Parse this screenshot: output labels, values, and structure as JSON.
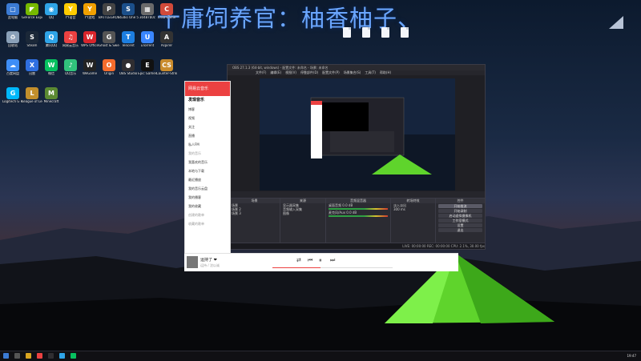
{
  "overlay_title": "十庸饲养官：柚香柚子、",
  "desktop_icons": [
    {
      "label": "此电脑",
      "color": "#3b7bd4",
      "glyph": "▢"
    },
    {
      "label": "GeForce Experience",
      "color": "#76b900",
      "glyph": "◤"
    },
    {
      "label": "QQ",
      "color": "#2fa4e7",
      "glyph": "◉"
    },
    {
      "label": "YY语音",
      "color": "#ffcc00",
      "glyph": "Y"
    },
    {
      "label": "YY游戏",
      "color": "#f0a000",
      "glyph": "Y"
    },
    {
      "label": "BATTLEGROUNDS",
      "color": "#444",
      "glyph": "P"
    },
    {
      "label": "Studio One 5",
      "color": "#1b4f8a",
      "glyph": "S"
    },
    {
      "label": "30487b0c",
      "color": "#6a6a6a",
      "glyph": "▦"
    },
    {
      "label": "Crab Game",
      "color": "#d04a3a",
      "glyph": "C"
    },
    {
      "label": "回收站",
      "color": "#8aa0b8",
      "glyph": "♻"
    },
    {
      "label": "Steam",
      "color": "#1b2838",
      "glyph": "S"
    },
    {
      "label": "腾讯QQ",
      "color": "#2fa4e7",
      "glyph": "Q"
    },
    {
      "label": "网易云音乐",
      "color": "#ec4141",
      "glyph": "♫"
    },
    {
      "label": "WPS Office",
      "color": "#d9262c",
      "glyph": "W"
    },
    {
      "label": "Ghost & Sweeper",
      "color": "#555",
      "glyph": "G"
    },
    {
      "label": "Tencent",
      "color": "#1d7ee0",
      "glyph": "T"
    },
    {
      "label": "uTorrent",
      "color": "#3a86ff",
      "glyph": "U"
    },
    {
      "label": "Aspirer",
      "color": "#333",
      "glyph": "A"
    },
    {
      "label": "百度网盘",
      "color": "#3e8ef7",
      "glyph": "☁"
    },
    {
      "label": "迅雷",
      "color": "#2f6fe0",
      "glyph": "X"
    },
    {
      "label": "微信",
      "color": "#07c160",
      "glyph": "W"
    },
    {
      "label": "QQ音乐",
      "color": "#31c27c",
      "glyph": "♪"
    },
    {
      "label": "WeGame",
      "color": "#222",
      "glyph": "W"
    },
    {
      "label": "Origin",
      "color": "#f56c2d",
      "glyph": "O"
    },
    {
      "label": "OBS Studio",
      "color": "#302e31",
      "glyph": "●"
    },
    {
      "label": "Epic Games",
      "color": "#111",
      "glyph": "E"
    },
    {
      "label": "Counter-Strike",
      "color": "#c98b2c",
      "glyph": "CS"
    },
    {
      "label": "Logitech G HUB",
      "color": "#00b8fc",
      "glyph": "G"
    },
    {
      "label": "League of Legends",
      "color": "#c28f2c",
      "glyph": "L"
    },
    {
      "label": "Minecraft",
      "color": "#5b8a32",
      "glyph": "M"
    }
  ],
  "obs": {
    "title": "OBS 27.1.3 (64-bit, windows) - 配置文件: 未命名 - 场景: 未命名",
    "menu": [
      "文件(F)",
      "编辑(E)",
      "视图(V)",
      "停靠部件(D)",
      "配置文件(P)",
      "场景集合(S)",
      "工具(T)",
      "帮助(H)"
    ],
    "dock_scenes": "场景",
    "dock_sources": "来源",
    "dock_mixer": "音频混音器",
    "dock_transitions": "转场特效",
    "dock_controls": "控件",
    "scenes": [
      "场景",
      "场景 2",
      "场景 3"
    ],
    "sources": [
      "显示器采集",
      "音频输入采集",
      "图像"
    ],
    "mixer_tracks": [
      {
        "name": "桌面音频",
        "level": "0.0 dB"
      },
      {
        "name": "麦克风/Aux",
        "level": "0.0 dB"
      }
    ],
    "transition": "淡入淡出",
    "duration": "300 ms",
    "controls": [
      "开始推流",
      "开始录制",
      "启动虚拟摄像机",
      "工作室模式",
      "设置",
      "退出"
    ],
    "status": "LIVE: 00:00:00   REC: 00:00:00   CPU: 2.1%, 30.00 fps"
  },
  "music": {
    "app_name": "网易云音乐",
    "nav": [
      "发现音乐",
      "博客",
      "视频",
      "关注",
      "直播",
      "私人FM"
    ],
    "section_my": "我的音乐",
    "my_items": [
      "我喜欢的音乐",
      "本地与下载",
      "最近播放",
      "我的音乐云盘",
      "我的播客",
      "我的收藏"
    ],
    "section_created": "创建的歌单",
    "section_fav": "收藏的歌单",
    "now_playing": "运持了 ❤",
    "artist": "运持 / 沈以诚"
  },
  "taskbar": {
    "time": "19:47"
  }
}
